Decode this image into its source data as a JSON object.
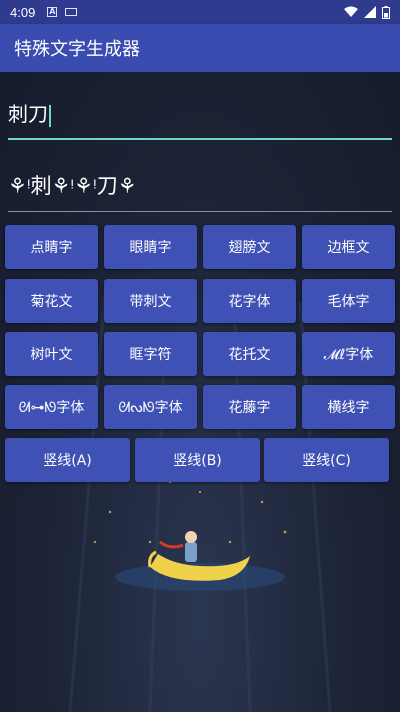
{
  "status_bar": {
    "time": "4:09"
  },
  "app_bar": {
    "title": "特殊文字生成器"
  },
  "input": {
    "value": "刺刀"
  },
  "output": {
    "value": "ꔷ刺ꔷꔷ刀ꔷ",
    "display": "⚘ᵎ刺⚘ᵎ⚘ᵎ刀⚘"
  },
  "buttons": {
    "row1": [
      "点睛字",
      "眼睛字",
      "翅膀文",
      "边框文"
    ],
    "row2": [
      "菊花文",
      "带刺文",
      "花字体",
      "毛体字"
    ],
    "row3": [
      "树叶文",
      "眶字符",
      "花托文",
      "𝓜ℓ字体"
    ],
    "row4": [
      "ᘛ⊶ᘚ字体",
      "ᘛᔓᘚ字体",
      "花藤字",
      "横线字"
    ],
    "row5": [
      "竖线(A)",
      "竖线(B)",
      "竖线(C)"
    ]
  },
  "colors": {
    "app_bar": "#3a4cb0",
    "status_bar": "#2f3b8e",
    "button": "#3f51b5",
    "accent_line": "#6fd6c8",
    "background": "#1c2336"
  }
}
